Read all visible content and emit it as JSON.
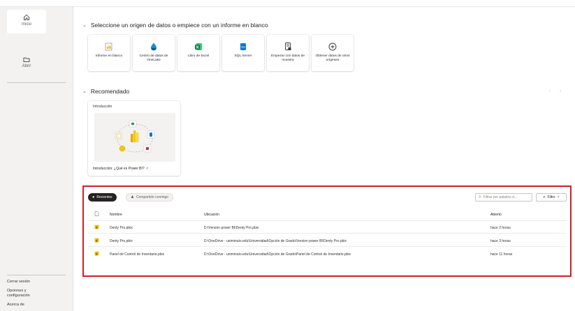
{
  "rail": {
    "home_label": "Inicio",
    "open_label": "Abrir",
    "signout_label": "Cerrar sesión",
    "options_label": "Opciones y configuración",
    "about_label": "Acerca de"
  },
  "start": {
    "heading": "Seleccione un origen de datos o empiece con un informe en blanco",
    "tiles": [
      {
        "label": "Informe en blanco",
        "icon": "blank-report-icon"
      },
      {
        "label": "Centro de datos de OneLake",
        "icon": "onelake-icon"
      },
      {
        "label": "Libro de Excel",
        "icon": "excel-icon"
      },
      {
        "label": "SQL Server",
        "icon": "sql-server-icon"
      },
      {
        "label": "Empezar con datos de muestra",
        "icon": "sample-data-icon"
      },
      {
        "label": "Obtener datos de otros orígenes",
        "icon": "add-icon"
      }
    ]
  },
  "recommended": {
    "heading": "Recomendado",
    "card_caption": "Introducción",
    "card_title": "Introducción: ¿Qué es Power BI?"
  },
  "files": {
    "tab_recent": "Recientes",
    "tab_shared": "Compartido conmigo",
    "filter_placeholder": "Filtrar por palabra cl...",
    "filter_button": "Filtro",
    "columns": {
      "name": "Nombre",
      "location": "Ubicación",
      "opened": "Abierto"
    },
    "rows": [
      {
        "name": "Denty Pro.pbix",
        "location": "D:\\Version power BI\\Denty Pro.pbix",
        "opened": "hace 2 horas"
      },
      {
        "name": "Denty Pro.pbix",
        "location": "D:\\OneDrive - uniminuto.edu\\Universidad\\Opción de Grado\\Version power BI\\Denty Pro.pbix",
        "opened": "hace 3 horas"
      },
      {
        "name": "Panel de Control de Inventario.pbix",
        "location": "D:\\OneDrive - uniminuto.edu\\Universidad\\Opción de Grado\\Panel de Control de Inventario.pbix",
        "opened": "hace 11 horas"
      }
    ]
  },
  "colors": {
    "highlight": "#d21f28",
    "brand": "#f2c811"
  }
}
